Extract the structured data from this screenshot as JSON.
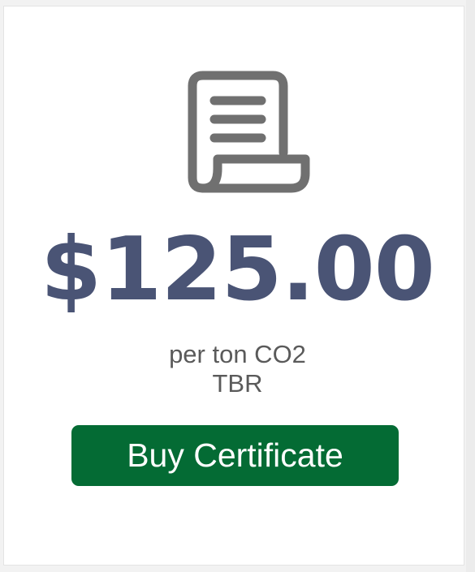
{
  "product": {
    "icon": "receipt-document-icon",
    "price": "$125.00",
    "unit": "per ton CO2",
    "subtext": "TBR",
    "button_label": "Buy Certificate"
  },
  "colors": {
    "price": "#4a5475",
    "button_background": "#046b34",
    "button_text": "#ffffff",
    "icon": "#707070",
    "text": "#5a5a5a"
  }
}
